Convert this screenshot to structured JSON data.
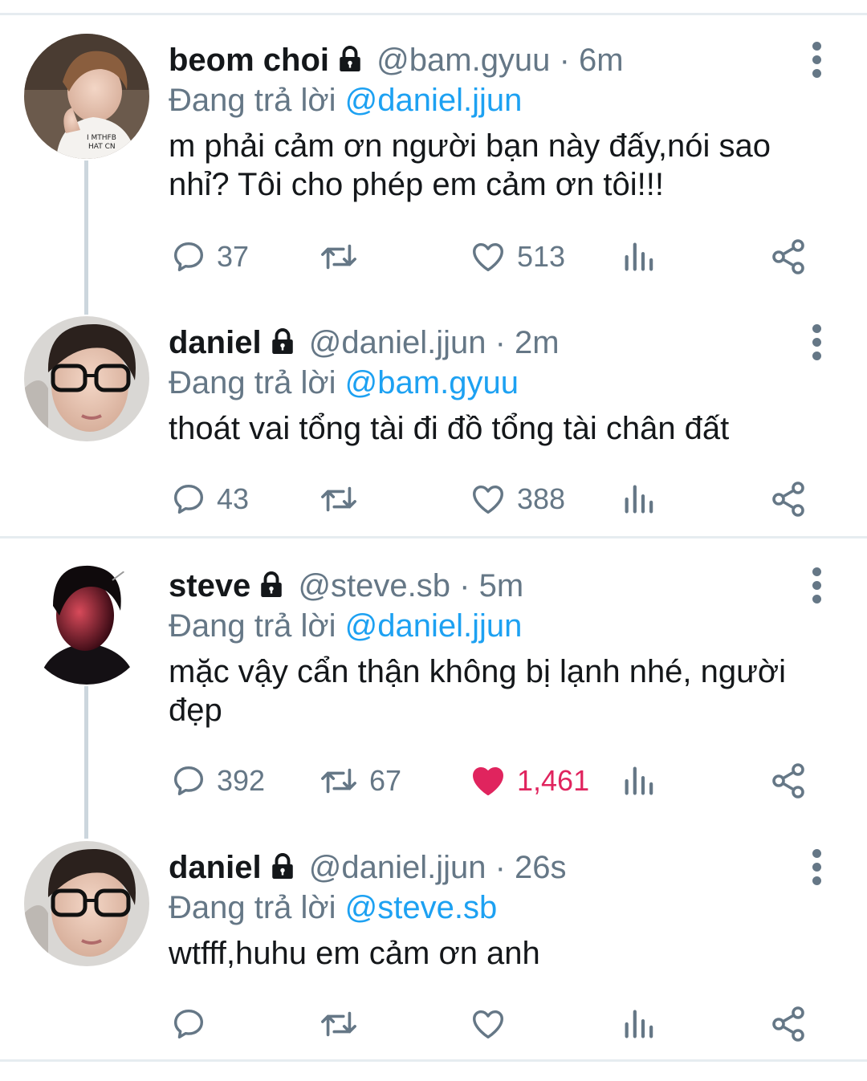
{
  "tweets": [
    {
      "name": "beom choi",
      "handle": "@bam.gyuu",
      "separator": "·",
      "time": "6m",
      "reply_prefix": "Đang trả lời",
      "reply_to": "@daniel.jjun",
      "text": "m phải cảm ơn người bạn này đấy,nói sao nhỉ? Tôi cho phép em cảm ơn tôi!!!",
      "replies": "37",
      "retweets": "",
      "likes": "513",
      "liked": false,
      "avatar": "photo-person-white-shirt"
    },
    {
      "name": "daniel",
      "handle": "@daniel.jjun",
      "separator": "·",
      "time": "2m",
      "reply_prefix": "Đang trả lời",
      "reply_to": "@bam.gyuu",
      "text": "thoát vai tổng tài đi đồ tổng tài chân đất",
      "replies": "43",
      "retweets": "",
      "likes": "388",
      "liked": false,
      "avatar": "photo-person-glasses"
    },
    {
      "name": "steve",
      "handle": "@steve.sb",
      "separator": "·",
      "time": "5m",
      "reply_prefix": "Đang trả lời",
      "reply_to": "@daniel.jjun",
      "text": "mặc vậy cẩn thận không bị lạnh nhé, người đẹp",
      "replies": "392",
      "retweets": "67",
      "likes": "1,461",
      "liked": true,
      "avatar": "photo-person-dark"
    },
    {
      "name": "daniel",
      "handle": "@daniel.jjun",
      "separator": "·",
      "time": "26s",
      "reply_prefix": "Đang trả lời",
      "reply_to": "@steve.sb",
      "text": "wtfff,huhu em cảm ơn anh",
      "replies": "",
      "retweets": "",
      "likes": "",
      "liked": false,
      "avatar": "photo-person-glasses"
    }
  ],
  "icons": {
    "lock": "lock-icon",
    "reply": "reply-icon",
    "retweet": "retweet-icon",
    "like": "heart-icon",
    "analytics": "analytics-icon",
    "share": "share-icon",
    "more": "more-icon"
  },
  "colors": {
    "accent": "#1da1f2",
    "like": "#e0245e",
    "secondary_text": "#657786",
    "divider": "#e6ecf0"
  }
}
